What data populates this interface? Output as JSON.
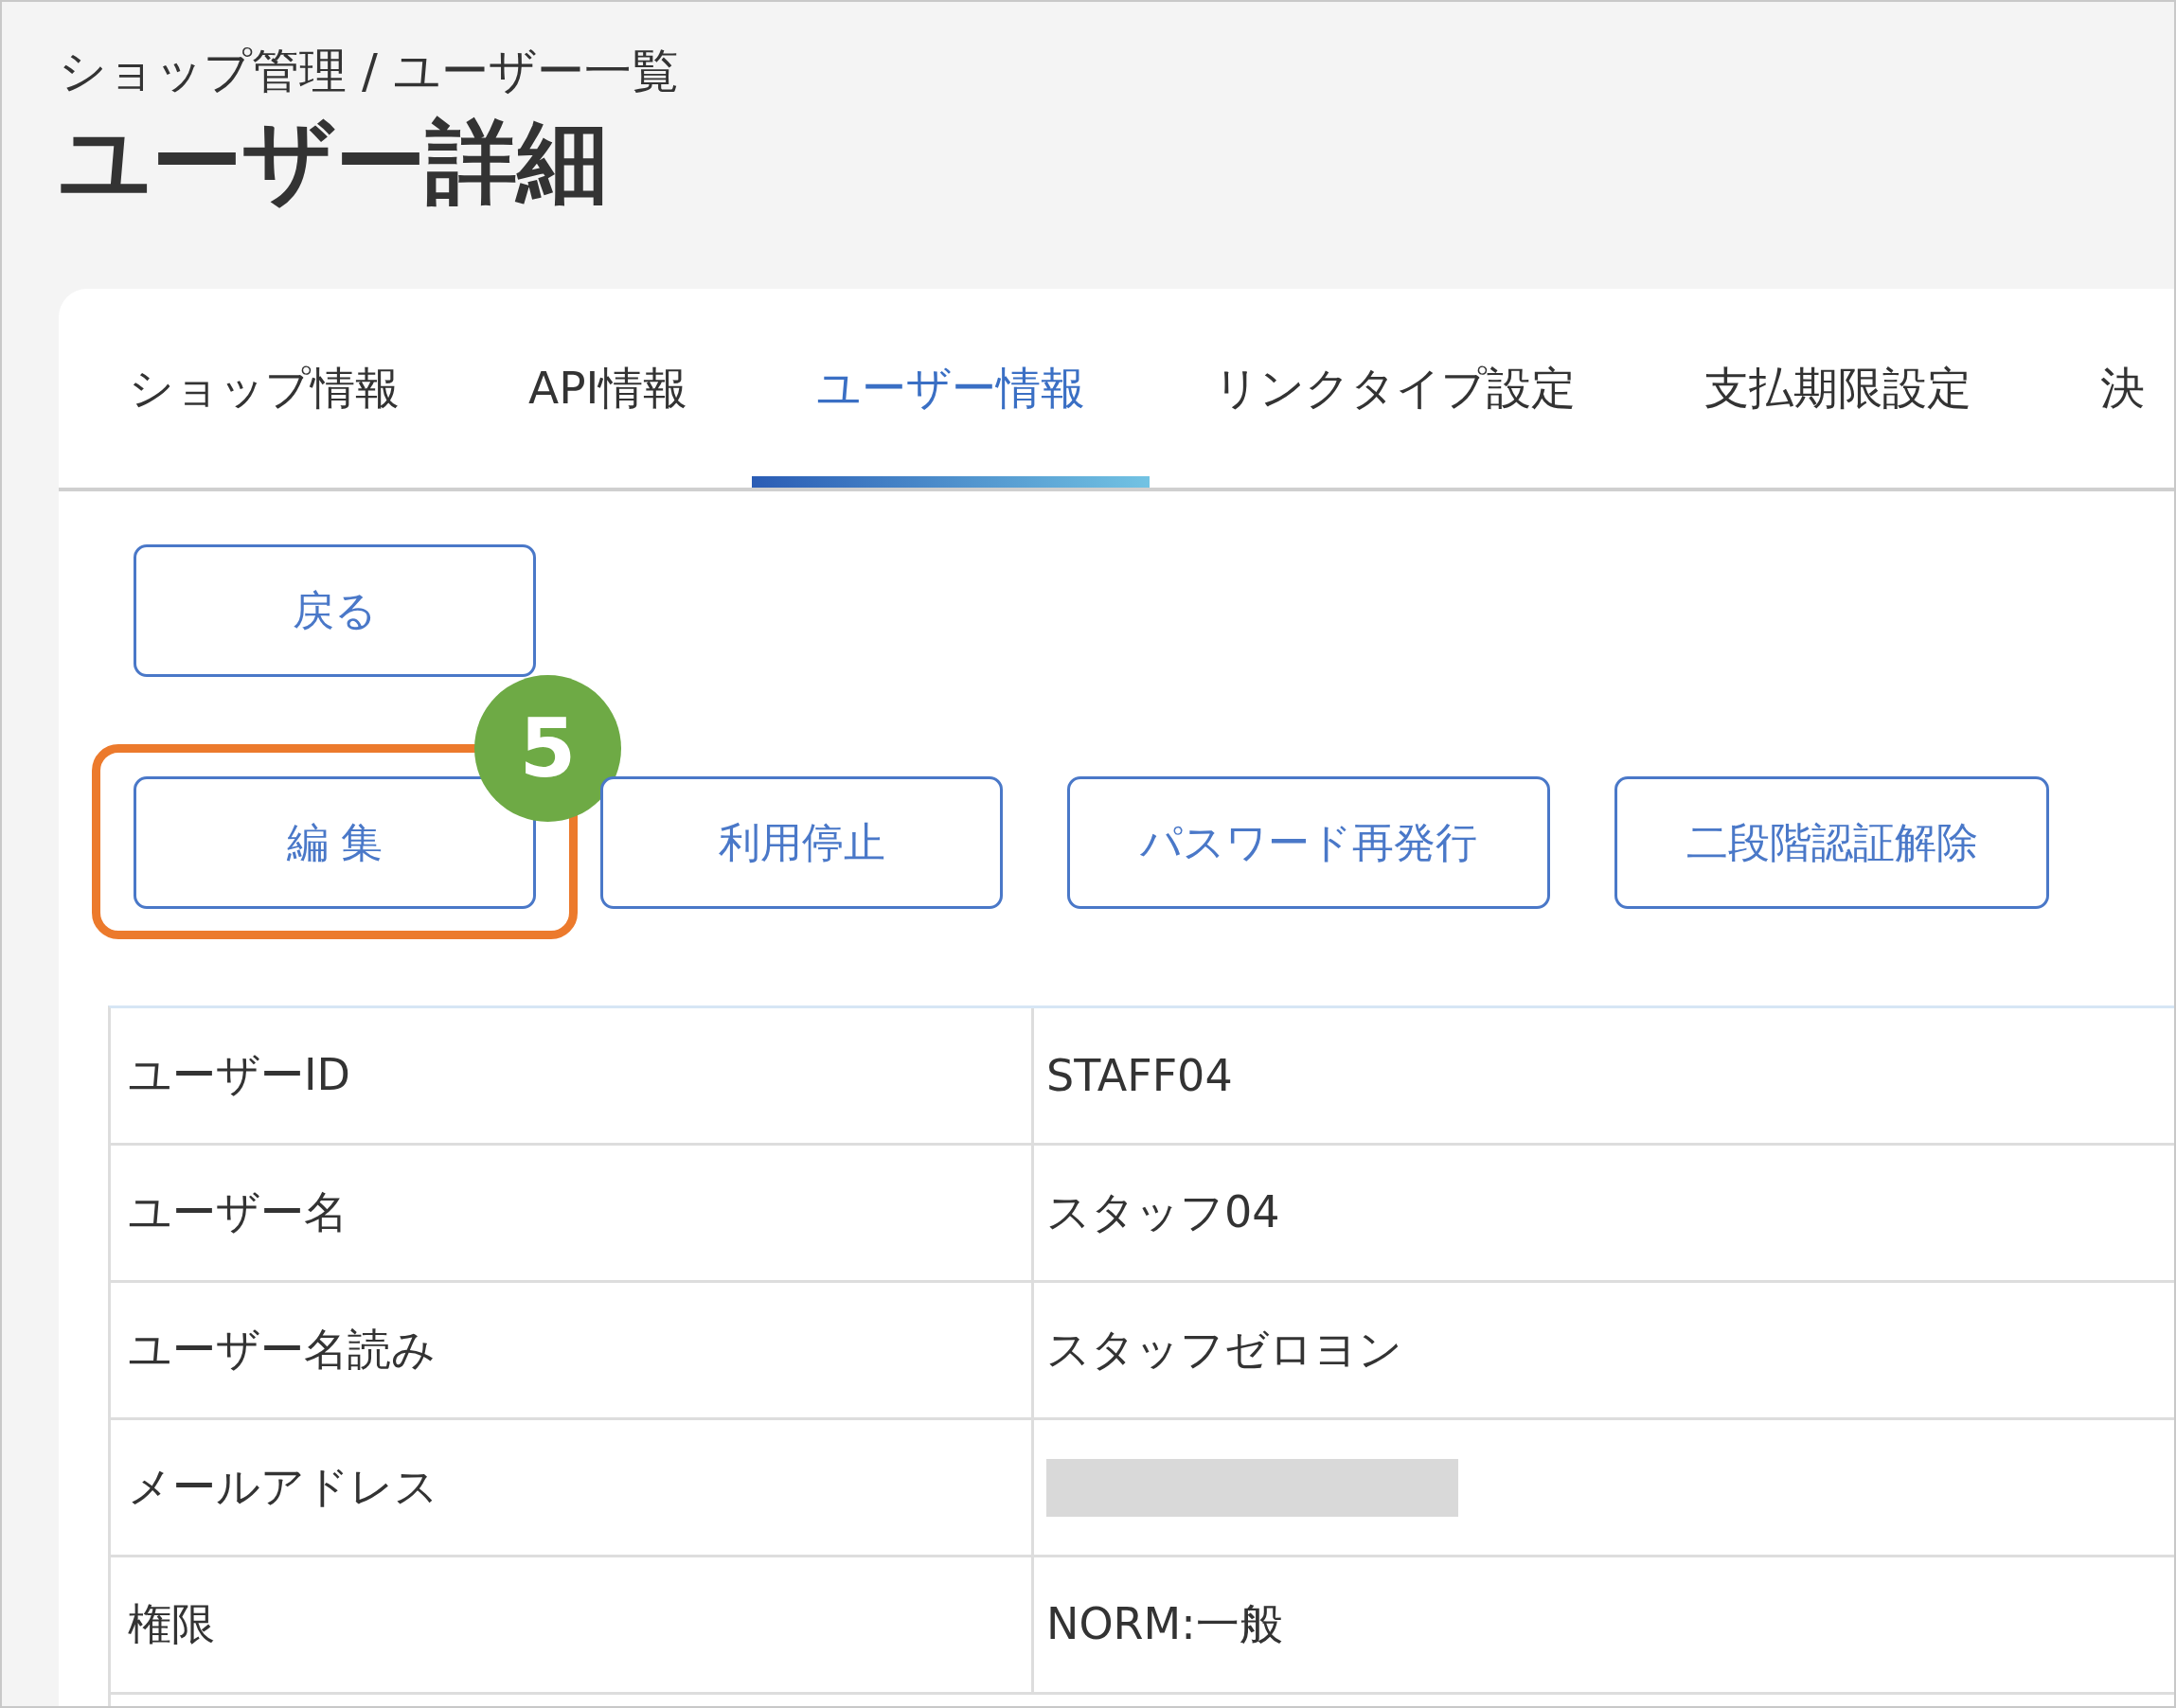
{
  "breadcrumb": "ショップ管理 / ユーザー一覧",
  "title": "ユーザー詳細",
  "tabs": [
    {
      "label": "ショップ情報",
      "selected": false
    },
    {
      "label": "API情報",
      "selected": false
    },
    {
      "label": "ユーザー情報",
      "selected": true
    },
    {
      "label": "リンクタイプ設定",
      "selected": false
    },
    {
      "label": "支払期限設定",
      "selected": false
    },
    {
      "label": "決",
      "selected": false
    }
  ],
  "back_button": "戻る",
  "actions": [
    {
      "label": "編 集",
      "highlighted": true,
      "callout": "5"
    },
    {
      "label": "利用停止",
      "highlighted": false
    },
    {
      "label": "パスワード再発行",
      "highlighted": false
    },
    {
      "label": "二段階認証解除",
      "highlighted": false
    }
  ],
  "details": [
    {
      "kind": "text",
      "label": "ユーザーID",
      "value": "STAFF04"
    },
    {
      "kind": "text",
      "label": "ユーザー名",
      "value": "スタッフ04"
    },
    {
      "kind": "text",
      "label": "ユーザー名読み",
      "value": "スタッフゼロヨン"
    },
    {
      "kind": "redacted",
      "label": "メールアドレス"
    },
    {
      "kind": "text",
      "label": "権限",
      "value": "NORM:一般"
    }
  ]
}
